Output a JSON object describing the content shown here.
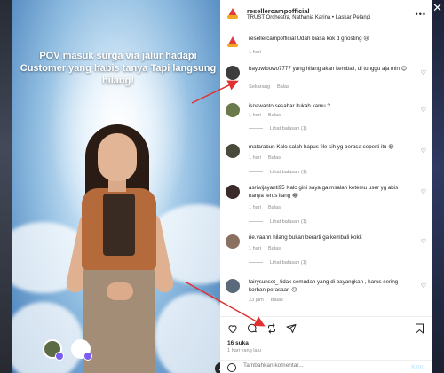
{
  "post": {
    "username": "resellercampofficial",
    "subtitle": "TRUST Orchestra, Nathania Karina • Laskar Pelangi",
    "media_text": "POV masuk surga via jalur hadapi Customer yang habis tanya Tapi langsung hilang!",
    "caption": {
      "username": "resellercampofficial",
      "text": "Udah biasa kok d ghosting 😢",
      "time": "1 hari"
    }
  },
  "comments": [
    {
      "username": "bayuwibowo7777",
      "text": "yang hilang akan kembali, di tunggu aja min 😊",
      "time": "Sekarang",
      "reply": "Balas",
      "replies": "",
      "avatar_color": "#3d3d3d"
    },
    {
      "username": "isnawanto",
      "text": "sesabar itukah kamu ?",
      "time": "1 hari",
      "reply": "Balas",
      "replies": "Lihat balasan (1)",
      "avatar_color": "#6a7a4a"
    },
    {
      "username": "matarabun",
      "text": "Kalo salah hapus file sih yg berasa seperti itu 😆",
      "time": "1 hari",
      "reply": "Balas",
      "replies": "Lihat balasan (1)",
      "avatar_color": "#4a4a3a"
    },
    {
      "username": "asriwijayanti95",
      "text": "Kalo gini saya ga msalah ketemu user yg abis nanya terus ilang 😂",
      "time": "1 hari",
      "reply": "Balas",
      "replies": "Lihat balasan (1)",
      "avatar_color": "#3a2a2a"
    },
    {
      "username": "rie.vaann",
      "text": "hilang bukan berarti ga kembali kokk",
      "time": "1 hari",
      "reply": "Balas",
      "replies": "Lihat balasan (1)",
      "avatar_color": "#8a7060"
    },
    {
      "username": "fairysunset_",
      "text": "tidak semudah yang di bayangkan , harus sering korban perasaan 😐",
      "time": "23 jam",
      "reply": "Balas",
      "replies": "",
      "avatar_color": "#5a6a7a"
    }
  ],
  "actions": {
    "likes": "16 suka",
    "time_ago": "1 hari yang lalu",
    "comment_placeholder": "Tambahkan komentar...",
    "post_label": "Kirim"
  },
  "icons": {
    "like": "heart-icon",
    "comment": "comment-icon",
    "repost": "repost-icon",
    "share": "share-icon",
    "save": "bookmark-icon",
    "more": "more-icon",
    "emoji": "emoji-icon",
    "close": "close-icon"
  },
  "colors": {
    "annotation_arrow": "#e03030",
    "secondary_text": "#8e8e8e",
    "post_button": "#b2dffc"
  }
}
